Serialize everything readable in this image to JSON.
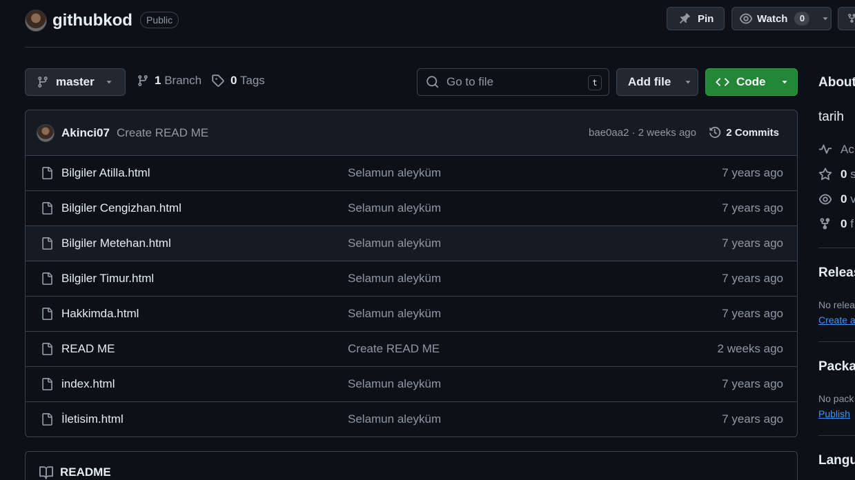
{
  "repo": {
    "name": "githubkod",
    "visibility": "Public"
  },
  "header_actions": {
    "pin_label": "Pin",
    "watch_label": "Watch",
    "watch_count": "0"
  },
  "toolbar": {
    "branch": "master",
    "branches_count": "1",
    "branches_label": "Branch",
    "tags_count": "0",
    "tags_label": "Tags",
    "goto_placeholder": "Go to file",
    "goto_shortcut": "t",
    "add_file_label": "Add file",
    "code_label": "Code"
  },
  "latest_commit": {
    "author": "Akinci07",
    "message": "Create READ ME",
    "meta": "bae0aa2 · 2 weeks ago",
    "commits_count": "2",
    "commits_label": "Commits"
  },
  "files": [
    {
      "name": "Bilgiler Atilla.html",
      "message": "Selamun aleyküm",
      "date": "7 years ago"
    },
    {
      "name": "Bilgiler Cengizhan.html",
      "message": "Selamun aleyküm",
      "date": "7 years ago"
    },
    {
      "name": "Bilgiler Metehan.html",
      "message": "Selamun aleyküm",
      "date": "7 years ago"
    },
    {
      "name": "Bilgiler Timur.html",
      "message": "Selamun aleyküm",
      "date": "7 years ago"
    },
    {
      "name": "Hakkimda.html",
      "message": "Selamun aleyküm",
      "date": "7 years ago"
    },
    {
      "name": "READ ME",
      "message": "Create READ ME",
      "date": "2 weeks ago"
    },
    {
      "name": "index.html",
      "message": "Selamun aleyküm",
      "date": "7 years ago"
    },
    {
      "name": "İletisim.html",
      "message": "Selamun aleyküm",
      "date": "7 years ago"
    }
  ],
  "readme": {
    "label": "README"
  },
  "sidebar": {
    "about_title": "About",
    "description": "tarih",
    "activity_label": "Ac",
    "stars": {
      "count": "0",
      "label": "s"
    },
    "watchers": {
      "count": "0",
      "label": "v"
    },
    "forks": {
      "count": "0",
      "label": "f"
    },
    "releases_title": "Releas",
    "releases_text": "No relea",
    "releases_link": "Create a",
    "packages_title": "Packa",
    "packages_text": "No pack",
    "packages_link": "Publish ",
    "languages_title": "Langu"
  }
}
